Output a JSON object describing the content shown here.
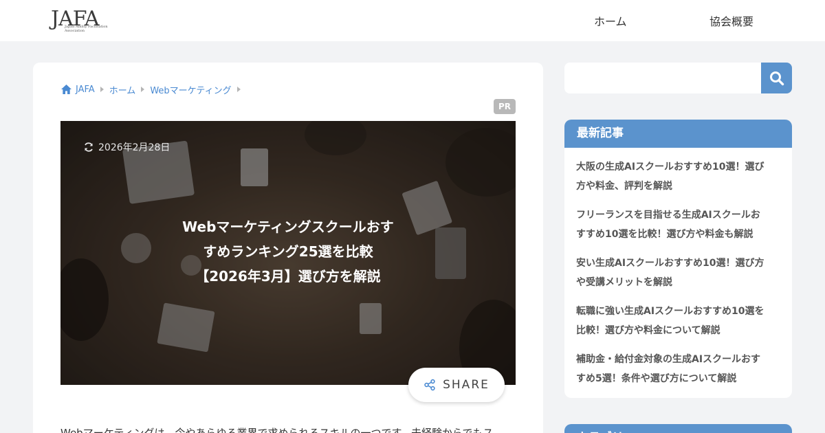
{
  "header": {
    "logo_text": "JAFA",
    "logo_subtitle": "Japan Ability Facilitation Association",
    "nav": [
      {
        "label": "ホーム"
      },
      {
        "label": "協会概要"
      }
    ]
  },
  "breadcrumb": {
    "items": [
      "JAFA",
      "ホーム",
      "Webマーケティング"
    ]
  },
  "article": {
    "pr_badge": "PR",
    "date": "2026年2月28日",
    "title_lines": [
      "Webマーケティングスクールおす",
      "すめランキング25選を比較",
      "【2026年3月】選び方を解説"
    ],
    "share_label": "SHARE",
    "intro": "Webマーケティングは、今やあらゆる業界で求められるスキルの一つです。未経験からでもス"
  },
  "sidebar": {
    "search": {
      "placeholder": "",
      "icon": "search-icon"
    },
    "recent": {
      "heading": "最新記事",
      "items": [
        {
          "line1": "大阪の生成AIスクールおすすめ10選！選び",
          "line2": "方や料金、評判を解説"
        },
        {
          "line1": "フリーランスを目指せる生成AIスクールお",
          "line2": "すすめ10選を比較！選び方や料金も解説"
        },
        {
          "line1": "安い生成AIスクールおすすめ10選！選び方",
          "line2": "や受講メリットを解説"
        },
        {
          "line1": "転職に強い生成AIスクールおすすめ10選を",
          "line2": "比較！選び方や料金について解説"
        },
        {
          "line1": "補助金・給付金対象の生成AIスクールおす",
          "line2": "すめ5選！条件や選び方について解説"
        }
      ]
    },
    "categories": {
      "heading": "カテゴリー"
    }
  },
  "colors": {
    "accent": "#5b93cd",
    "link": "#4a8ad2",
    "background": "#f2f3f5",
    "pr_badge": "#b8b8b8"
  }
}
